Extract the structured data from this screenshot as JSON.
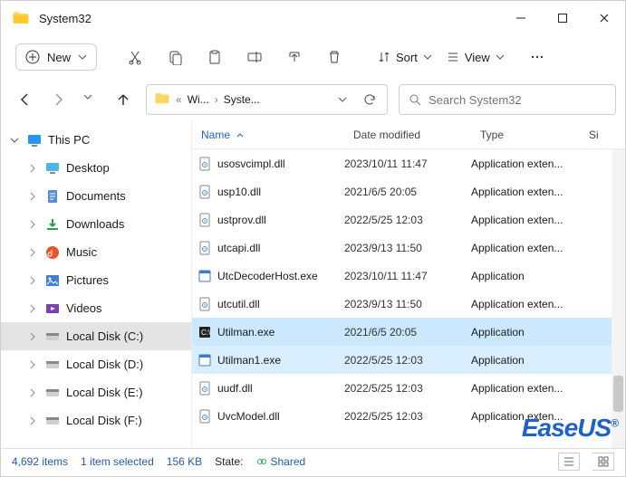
{
  "window": {
    "title": "System32"
  },
  "toolbar": {
    "new": "New",
    "sort": "Sort",
    "view": "View"
  },
  "breadcrumb": {
    "seg1": "Wi...",
    "seg2": "Syste..."
  },
  "search": {
    "placeholder": "Search System32"
  },
  "tree": {
    "root": "This PC",
    "items": [
      {
        "label": "Desktop",
        "icon": "desktop"
      },
      {
        "label": "Documents",
        "icon": "documents"
      },
      {
        "label": "Downloads",
        "icon": "downloads"
      },
      {
        "label": "Music",
        "icon": "music"
      },
      {
        "label": "Pictures",
        "icon": "pictures"
      },
      {
        "label": "Videos",
        "icon": "videos"
      },
      {
        "label": "Local Disk (C:)",
        "icon": "disk",
        "selected": true
      },
      {
        "label": "Local Disk (D:)",
        "icon": "disk"
      },
      {
        "label": "Local Disk (E:)",
        "icon": "disk"
      },
      {
        "label": "Local Disk (F:)",
        "icon": "disk"
      }
    ]
  },
  "columns": {
    "name": "Name",
    "date": "Date modified",
    "type": "Type",
    "size": "Si"
  },
  "files": [
    {
      "name": "usosvcimpl.dll",
      "date": "2023/10/11 11:47",
      "type": "Application exten...",
      "kind": "dll"
    },
    {
      "name": "usp10.dll",
      "date": "2021/6/5 20:05",
      "type": "Application exten...",
      "kind": "dll"
    },
    {
      "name": "ustprov.dll",
      "date": "2022/5/25 12:03",
      "type": "Application exten...",
      "kind": "dll"
    },
    {
      "name": "utcapi.dll",
      "date": "2023/9/13 11:50",
      "type": "Application exten...",
      "kind": "dll"
    },
    {
      "name": "UtcDecoderHost.exe",
      "date": "2023/10/11 11:47",
      "type": "Application",
      "kind": "exe"
    },
    {
      "name": "utcutil.dll",
      "date": "2023/9/13 11:50",
      "type": "Application exten...",
      "kind": "dll"
    },
    {
      "name": "Utilman.exe",
      "date": "2021/6/5 20:05",
      "type": "Application",
      "kind": "cmd",
      "sel": 1
    },
    {
      "name": "Utilman1.exe",
      "date": "2022/5/25 12:03",
      "type": "Application",
      "kind": "exe",
      "sel": 2
    },
    {
      "name": "uudf.dll",
      "date": "2022/5/25 12:03",
      "type": "Application exten...",
      "kind": "dll"
    },
    {
      "name": "UvcModel.dll",
      "date": "2022/5/25 12:03",
      "type": "Application exten...",
      "kind": "dll"
    }
  ],
  "status": {
    "count": "4,692 items",
    "selection": "1 item selected",
    "size": "156 KB",
    "state_label": "State:",
    "state_value": "Shared"
  },
  "watermark": "EaseUS"
}
